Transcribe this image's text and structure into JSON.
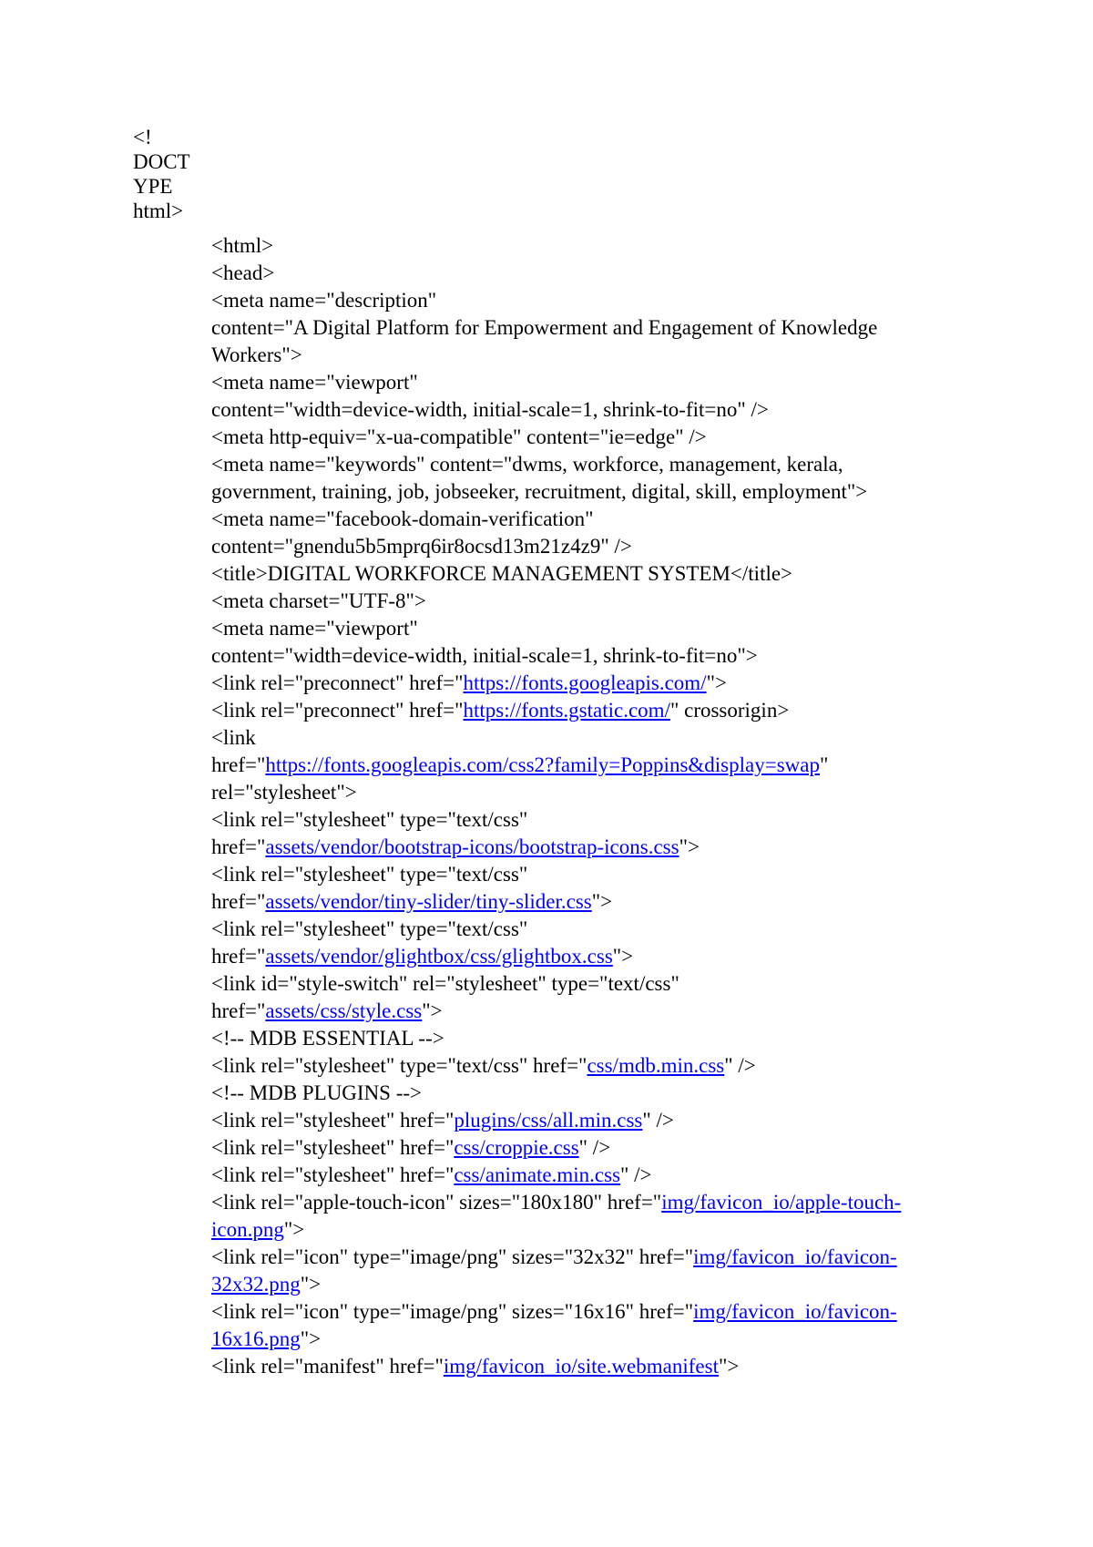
{
  "document": {
    "doctype_lines": [
      "<!",
      "DOCT",
      "YPE",
      "html>"
    ],
    "lines": [
      [
        {
          "t": "<html>"
        }
      ],
      [
        {
          "t": "<head>"
        }
      ],
      [
        {
          "t": "<meta name=\"description\""
        }
      ],
      [
        {
          "t": "content=\"A Digital Platform for Empowerment and Engagement of Knowledge Workers\">"
        }
      ],
      [
        {
          "t": "<meta name=\"viewport\""
        }
      ],
      [
        {
          "t": "content=\"width=device-width, initial-scale=1, shrink-to-fit=no\" />"
        }
      ],
      [
        {
          "t": "<meta http-equiv=\"x-ua-compatible\" content=\"ie=edge\" />"
        }
      ],
      [
        {
          "t": "<meta name=\"keywords\" content=\"dwms, workforce, management, kerala, government, training, job, jobseeker, recruitment, digital, skill, employment\">"
        }
      ],
      [
        {
          "t": "<meta name=\"facebook-domain-verification\""
        }
      ],
      [
        {
          "t": "content=\"gnendu5b5mprq6ir8ocsd13m21z4z9\" />"
        }
      ],
      [
        {
          "t": "<title>DIGITAL WORKFORCE MANAGEMENT SYSTEM</title>"
        }
      ],
      [
        {
          "t": "<meta charset=\"UTF-8\">"
        }
      ],
      [
        {
          "t": "<meta name=\"viewport\""
        }
      ],
      [
        {
          "t": "content=\"width=device-width, initial-scale=1, shrink-to-fit=no\">"
        }
      ],
      [
        {
          "t": "<link rel=\"preconnect\" href=\""
        },
        {
          "t": "https://fonts.googleapis.com/",
          "link": true
        },
        {
          "t": "\">"
        }
      ],
      [
        {
          "t": "<link rel=\"preconnect\" href=\""
        },
        {
          "t": "https://fonts.gstatic.com/",
          "link": true
        },
        {
          "t": "\" crossorigin>"
        }
      ],
      [
        {
          "t": "<link"
        }
      ],
      [
        {
          "t": "href=\""
        },
        {
          "t": "https://fonts.googleapis.com/css2?family=Poppins&display=swap",
          "link": true
        },
        {
          "t": "\""
        }
      ],
      [
        {
          "t": "rel=\"stylesheet\">"
        }
      ],
      [
        {
          "t": "<link rel=\"stylesheet\" type=\"text/css\""
        }
      ],
      [
        {
          "t": "href=\""
        },
        {
          "t": "assets/vendor/bootstrap-icons/bootstrap-icons.css",
          "link": true
        },
        {
          "t": "\">"
        }
      ],
      [
        {
          "t": "<link rel=\"stylesheet\" type=\"text/css\""
        }
      ],
      [
        {
          "t": "href=\""
        },
        {
          "t": "assets/vendor/tiny-slider/tiny-slider.css",
          "link": true
        },
        {
          "t": "\">"
        }
      ],
      [
        {
          "t": "<link rel=\"stylesheet\" type=\"text/css\""
        }
      ],
      [
        {
          "t": "href=\""
        },
        {
          "t": "assets/vendor/glightbox/css/glightbox.css",
          "link": true
        },
        {
          "t": "\">"
        }
      ],
      [
        {
          "t": "<link id=\"style-switch\" rel=\"stylesheet\" type=\"text/css\""
        }
      ],
      [
        {
          "t": "href=\""
        },
        {
          "t": "assets/css/style.css",
          "link": true
        },
        {
          "t": "\">"
        }
      ],
      [
        {
          "t": "<!-- MDB ESSENTIAL -->"
        }
      ],
      [
        {
          "t": "<link rel=\"stylesheet\" type=\"text/css\" href=\""
        },
        {
          "t": "css/mdb.min.css",
          "link": true
        },
        {
          "t": "\" />"
        }
      ],
      [
        {
          "t": "<!-- MDB PLUGINS -->"
        }
      ],
      [
        {
          "t": "<link rel=\"stylesheet\" href=\""
        },
        {
          "t": "plugins/css/all.min.css",
          "link": true
        },
        {
          "t": "\" />"
        }
      ],
      [
        {
          "t": "<link rel=\"stylesheet\" href=\""
        },
        {
          "t": "css/croppie.css",
          "link": true
        },
        {
          "t": "\" />"
        }
      ],
      [
        {
          "t": "<link rel=\"stylesheet\" href=\""
        },
        {
          "t": "css/animate.min.css",
          "link": true
        },
        {
          "t": "\" />"
        }
      ],
      [
        {
          "t": "<link rel=\"apple-touch-icon\" sizes=\"180x180\" href=\""
        },
        {
          "t": "img/favicon_io/apple-touch-icon.png",
          "link": true
        },
        {
          "t": "\">"
        }
      ],
      [
        {
          "t": "<link rel=\"icon\" type=\"image/png\" sizes=\"32x32\" href=\""
        },
        {
          "t": "img/favicon_io/favicon-32x32.png",
          "link": true
        },
        {
          "t": "\">"
        }
      ],
      [
        {
          "t": "<link rel=\"icon\" type=\"image/png\" sizes=\"16x16\" href=\""
        },
        {
          "t": "img/favicon_io/favicon-16x16.png",
          "link": true
        },
        {
          "t": "\">"
        }
      ],
      [
        {
          "t": "<link rel=\"manifest\" href=\""
        },
        {
          "t": "img/favicon_io/site.webmanifest",
          "link": true
        },
        {
          "t": "\">"
        }
      ]
    ]
  }
}
